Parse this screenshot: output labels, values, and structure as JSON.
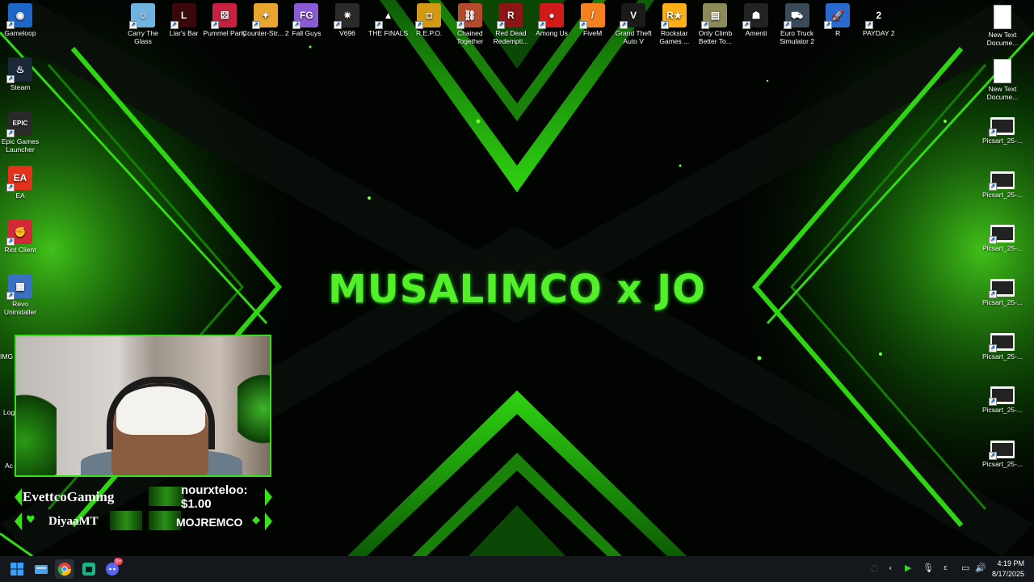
{
  "desktop": {
    "brand_text": "MUSALIMCO x JO",
    "left_icons": [
      {
        "name": "gameloop-icon",
        "label": "Gameloop",
        "bg": "#1e66c8",
        "glyph": "◉"
      },
      {
        "name": "steam-icon",
        "label": "Steam",
        "bg": "#1b2838",
        "glyph": "♨"
      },
      {
        "name": "epic-games-icon",
        "label": "Epic Games Launcher",
        "bg": "#2a2a2a",
        "glyph": "EPIC"
      },
      {
        "name": "ea-icon",
        "label": "EA",
        "bg": "#e3321b",
        "glyph": "EA"
      },
      {
        "name": "riot-client-icon",
        "label": "Riot Client",
        "bg": "#d32936",
        "glyph": "✊"
      },
      {
        "name": "revo-uninstaller-icon",
        "label": "Revo Uninstaller",
        "bg": "#3b6fc1",
        "glyph": "▦"
      }
    ],
    "top_icons": [
      {
        "name": "carry-the-glass-icon",
        "label": "Carry The Glass",
        "bg": "#6fb4e0",
        "glyph": "☺"
      },
      {
        "name": "liars-bar-icon",
        "label": "Liar's Bar",
        "bg": "#3a0808",
        "glyph": "L"
      },
      {
        "name": "pummel-party-icon",
        "label": "Pummel Party",
        "bg": "#c82040",
        "glyph": "⚄"
      },
      {
        "name": "counter-strike-2-icon",
        "label": "Counter-Str... 2",
        "bg": "#e8a630",
        "glyph": "✦"
      },
      {
        "name": "fall-guys-icon",
        "label": "Fall Guys",
        "bg": "#8b5bd6",
        "glyph": "FG"
      },
      {
        "name": "v696-icon",
        "label": "V696",
        "bg": "#2a2a2a",
        "glyph": "✷"
      },
      {
        "name": "the-finals-icon",
        "label": "THE FINALS",
        "bg": "transparent",
        "glyph": "▲"
      },
      {
        "name": "repo-icon",
        "label": "R.E.P.O.",
        "bg": "#d29a14",
        "glyph": "◘"
      },
      {
        "name": "chained-together-icon",
        "label": "Chained Together",
        "bg": "#b44b2c",
        "glyph": "⛓"
      },
      {
        "name": "red-dead-redemption-icon",
        "label": "Red Dead Redempti...",
        "bg": "#8c1515",
        "glyph": "R"
      },
      {
        "name": "among-us-icon",
        "label": "Among Us",
        "bg": "#d11a1a",
        "glyph": "●"
      },
      {
        "name": "fivem-icon",
        "label": "FiveM",
        "bg": "#f58020",
        "glyph": "/"
      },
      {
        "name": "gta-v-icon",
        "label": "Grand Theft Auto V",
        "bg": "#1a1a1a",
        "glyph": "V"
      },
      {
        "name": "rockstar-games-icon",
        "label": "Rockstar Games ...",
        "bg": "#fcaf17",
        "glyph": "R★"
      },
      {
        "name": "only-climb-icon",
        "label": "Only Climb Better To...",
        "bg": "#8b8b5a",
        "glyph": "▤"
      },
      {
        "name": "amenti-icon",
        "label": "Amenti",
        "bg": "#222",
        "glyph": "☗"
      },
      {
        "name": "euro-truck-icon",
        "label": "Euro Truck Simulator 2",
        "bg": "#3a4a5a",
        "glyph": "⛟"
      },
      {
        "name": "rocket-league-icon",
        "label": "R",
        "bg": "#2a6ad0",
        "glyph": "🚀"
      },
      {
        "name": "payday-2-icon",
        "label": "PAYDAY 2",
        "bg": "transparent",
        "glyph": "2"
      }
    ],
    "right_icons": [
      {
        "name": "text-document-icon",
        "label": "New Text Docume...",
        "type": "doc"
      },
      {
        "name": "text-document-icon",
        "label": "New Text Docume...",
        "type": "doc"
      },
      {
        "name": "picsart-image-icon",
        "label": "Picsart_25-...",
        "type": "img"
      },
      {
        "name": "picsart-image-icon",
        "label": "Picsart_25-...",
        "type": "img"
      },
      {
        "name": "picsart-image-icon",
        "label": "Picsart_25-...",
        "type": "img"
      },
      {
        "name": "picsart-image-icon",
        "label": "Picsart_25-...",
        "type": "img"
      },
      {
        "name": "picsart-image-icon",
        "label": "Picsart_25-...",
        "type": "img"
      },
      {
        "name": "picsart-image-icon",
        "label": "Picsart_25-...",
        "type": "img"
      },
      {
        "name": "picsart-image-icon",
        "label": "Picsart_25-...",
        "type": "img"
      }
    ],
    "partial_left_labels": [
      "IMG",
      "Log",
      "Ac"
    ]
  },
  "stream_overlay": {
    "latest_follower": "EvettcoGaming",
    "latest_donation": "nourxteloo: $1.00",
    "latest_subscriber": "DiyaaMT",
    "top_supporter": "MOJREMCO"
  },
  "taskbar": {
    "apps": [
      "start-icon",
      "file-explorer-icon",
      "chrome-icon",
      "app-icon",
      "discord-icon"
    ],
    "discord_badge": "9+",
    "time": "4:19 PM",
    "date": "8/17/2025"
  },
  "colors": {
    "accent_green": "#39e01c",
    "taskbar_bg": "#14181c"
  }
}
